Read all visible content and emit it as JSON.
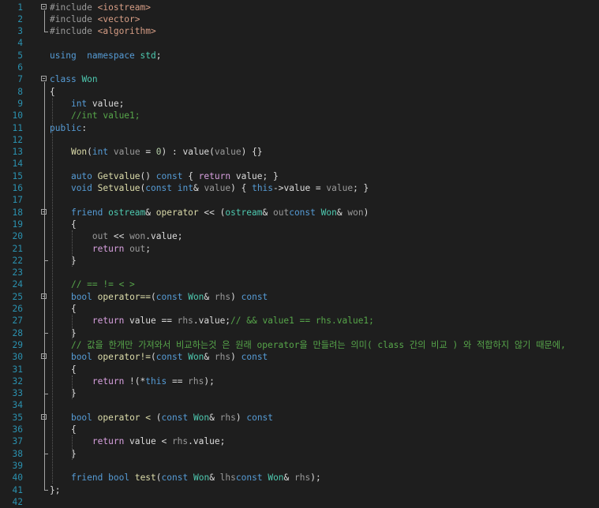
{
  "lines": [
    {
      "n": "1",
      "fold": true,
      "t": [
        [
          "pp",
          "#include "
        ],
        [
          "str",
          "<iostream>"
        ]
      ]
    },
    {
      "n": "2",
      "t": [
        [
          "pp",
          "#include "
        ],
        [
          "str",
          "<vector>"
        ]
      ]
    },
    {
      "n": "3",
      "t": [
        [
          "pp",
          "#include "
        ],
        [
          "str",
          "<algorithm>"
        ]
      ]
    },
    {
      "n": "4",
      "t": []
    },
    {
      "n": "5",
      "t": [
        [
          "kw",
          "using"
        ],
        [
          "",
          "  "
        ],
        [
          "kw",
          "namespace"
        ],
        [
          "",
          " "
        ],
        [
          "ty",
          "std"
        ],
        [
          "",
          ";"
        ]
      ]
    },
    {
      "n": "6",
      "t": []
    },
    {
      "n": "7",
      "fold": true,
      "t": [
        [
          "kw",
          "class"
        ],
        [
          "",
          " "
        ],
        [
          "ty",
          "Won"
        ]
      ]
    },
    {
      "n": "8",
      "t": [
        [
          "",
          "{"
        ]
      ]
    },
    {
      "n": "9",
      "t": [
        [
          "",
          "    "
        ],
        [
          "kw",
          "int"
        ],
        [
          "",
          " value;"
        ]
      ]
    },
    {
      "n": "10",
      "t": [
        [
          "",
          "    "
        ],
        [
          "cm",
          "//int value1;"
        ]
      ]
    },
    {
      "n": "11",
      "t": [
        [
          "kw",
          "public"
        ],
        [
          "",
          ":"
        ]
      ]
    },
    {
      "n": "12",
      "t": []
    },
    {
      "n": "13",
      "t": [
        [
          "",
          "    "
        ],
        [
          "fn",
          "Won"
        ],
        [
          "",
          "("
        ],
        [
          "kw",
          "int"
        ],
        [
          "",
          " "
        ],
        [
          "pm",
          "value"
        ],
        [
          "",
          " = "
        ],
        [
          "nm",
          "0"
        ],
        [
          "",
          ") : value("
        ],
        [
          "pm",
          "value"
        ],
        [
          "",
          ") {}"
        ]
      ]
    },
    {
      "n": "14",
      "t": []
    },
    {
      "n": "15",
      "t": [
        [
          "",
          "    "
        ],
        [
          "kw",
          "auto"
        ],
        [
          "",
          " "
        ],
        [
          "fn",
          "Getvalue"
        ],
        [
          "",
          "() "
        ],
        [
          "kw",
          "const"
        ],
        [
          "",
          " { "
        ],
        [
          "ctl",
          "return"
        ],
        [
          "",
          " value; }"
        ]
      ]
    },
    {
      "n": "16",
      "t": [
        [
          "",
          "    "
        ],
        [
          "kw",
          "void"
        ],
        [
          "",
          " "
        ],
        [
          "fn",
          "Setvalue"
        ],
        [
          "",
          "("
        ],
        [
          "kw",
          "const"
        ],
        [
          "",
          " "
        ],
        [
          "kw",
          "int"
        ],
        [
          "",
          "& "
        ],
        [
          "pm",
          "value"
        ],
        [
          "",
          ") { "
        ],
        [
          "kw",
          "this"
        ],
        [
          "",
          "->value = "
        ],
        [
          "pm",
          "value"
        ],
        [
          "",
          "; }"
        ]
      ]
    },
    {
      "n": "17",
      "t": []
    },
    {
      "n": "18",
      "fold": true,
      "t": [
        [
          "",
          "    "
        ],
        [
          "kw",
          "friend"
        ],
        [
          "",
          " "
        ],
        [
          "ty",
          "ostream"
        ],
        [
          "",
          "& "
        ],
        [
          "fn",
          "operator"
        ],
        [
          "",
          " << ("
        ],
        [
          "ty",
          "ostream"
        ],
        [
          "",
          "& "
        ],
        [
          "pm",
          "out"
        ],
        [
          ", "
        ],
        [
          "kw",
          "const"
        ],
        [
          "",
          " "
        ],
        [
          "ty",
          "Won"
        ],
        [
          "",
          "& "
        ],
        [
          "pm",
          "won"
        ],
        [
          "",
          ")"
        ]
      ]
    },
    {
      "n": "19",
      "t": [
        [
          "",
          "    {"
        ]
      ]
    },
    {
      "n": "20",
      "t": [
        [
          "",
          "        "
        ],
        [
          "pm",
          "out"
        ],
        [
          "",
          " << "
        ],
        [
          "pm",
          "won"
        ],
        [
          "",
          ".value;"
        ]
      ]
    },
    {
      "n": "21",
      "t": [
        [
          "",
          "        "
        ],
        [
          "ctl",
          "return"
        ],
        [
          "",
          " "
        ],
        [
          "pm",
          "out"
        ],
        [
          "",
          ";"
        ]
      ]
    },
    {
      "n": "22",
      "t": [
        [
          "",
          "    }"
        ]
      ]
    },
    {
      "n": "23",
      "t": []
    },
    {
      "n": "24",
      "t": [
        [
          "",
          "    "
        ],
        [
          "cm",
          "// == != < >"
        ]
      ]
    },
    {
      "n": "25",
      "fold": true,
      "t": [
        [
          "",
          "    "
        ],
        [
          "kw",
          "bool"
        ],
        [
          "",
          " "
        ],
        [
          "fn",
          "operator=="
        ],
        [
          "",
          "("
        ],
        [
          "kw",
          "const"
        ],
        [
          "",
          " "
        ],
        [
          "ty",
          "Won"
        ],
        [
          "",
          "& "
        ],
        [
          "pm",
          "rhs"
        ],
        [
          "",
          ") "
        ],
        [
          "kw",
          "const"
        ]
      ]
    },
    {
      "n": "26",
      "t": [
        [
          "",
          "    {"
        ]
      ]
    },
    {
      "n": "27",
      "t": [
        [
          "",
          "        "
        ],
        [
          "ctl",
          "return"
        ],
        [
          "",
          " value == "
        ],
        [
          "pm",
          "rhs"
        ],
        [
          "",
          ".value;"
        ],
        [
          "cm",
          "// && value1 == rhs.value1;"
        ]
      ]
    },
    {
      "n": "28",
      "t": [
        [
          "",
          "    }"
        ]
      ]
    },
    {
      "n": "29",
      "t": [
        [
          "",
          "    "
        ],
        [
          "cm",
          "// 값을 한개만 가져와서 비교하는것 은 원래 operator을 만들려는 의미( class 간의 비교 ) 와 적합하지 않기 때문에,"
        ]
      ]
    },
    {
      "n": "30",
      "fold": true,
      "t": [
        [
          "",
          "    "
        ],
        [
          "kw",
          "bool"
        ],
        [
          "",
          " "
        ],
        [
          "fn",
          "operator!="
        ],
        [
          "",
          "("
        ],
        [
          "kw",
          "const"
        ],
        [
          "",
          " "
        ],
        [
          "ty",
          "Won"
        ],
        [
          "",
          "& "
        ],
        [
          "pm",
          "rhs"
        ],
        [
          "",
          ") "
        ],
        [
          "kw",
          "const"
        ]
      ]
    },
    {
      "n": "31",
      "t": [
        [
          "",
          "    {"
        ]
      ]
    },
    {
      "n": "32",
      "t": [
        [
          "",
          "        "
        ],
        [
          "ctl",
          "return"
        ],
        [
          "",
          " !(*"
        ],
        [
          "kw",
          "this"
        ],
        [
          "",
          " == "
        ],
        [
          "pm",
          "rhs"
        ],
        [
          "",
          ");"
        ]
      ]
    },
    {
      "n": "33",
      "t": [
        [
          "",
          "    }"
        ]
      ]
    },
    {
      "n": "34",
      "t": []
    },
    {
      "n": "35",
      "fold": true,
      "t": [
        [
          "",
          "    "
        ],
        [
          "kw",
          "bool"
        ],
        [
          "",
          " "
        ],
        [
          "fn",
          "operator <"
        ],
        [
          "",
          " ("
        ],
        [
          "kw",
          "const"
        ],
        [
          "",
          " "
        ],
        [
          "ty",
          "Won"
        ],
        [
          "",
          "& "
        ],
        [
          "pm",
          "rhs"
        ],
        [
          "",
          ") "
        ],
        [
          "kw",
          "const"
        ]
      ]
    },
    {
      "n": "36",
      "t": [
        [
          "",
          "    {"
        ]
      ]
    },
    {
      "n": "37",
      "t": [
        [
          "",
          "        "
        ],
        [
          "ctl",
          "return"
        ],
        [
          "",
          " value < "
        ],
        [
          "pm",
          "rhs"
        ],
        [
          "",
          ".value;"
        ]
      ]
    },
    {
      "n": "38",
      "t": [
        [
          "",
          "    }"
        ]
      ]
    },
    {
      "n": "39",
      "t": []
    },
    {
      "n": "40",
      "t": [
        [
          "",
          "    "
        ],
        [
          "kw",
          "friend"
        ],
        [
          "",
          " "
        ],
        [
          "kw",
          "bool"
        ],
        [
          "",
          " "
        ],
        [
          "fn",
          "test"
        ],
        [
          "",
          "("
        ],
        [
          "kw",
          "const"
        ],
        [
          "",
          " "
        ],
        [
          "ty",
          "Won"
        ],
        [
          "",
          "& "
        ],
        [
          "pm",
          "lhs"
        ],
        [
          ", "
        ],
        [
          "kw",
          "const"
        ],
        [
          "",
          " "
        ],
        [
          "ty",
          "Won"
        ],
        [
          "",
          "& "
        ],
        [
          "pm",
          "rhs"
        ],
        [
          "",
          ");"
        ]
      ]
    },
    {
      "n": "41",
      "t": [
        [
          "",
          "};"
        ]
      ]
    },
    {
      "n": "42",
      "t": []
    }
  ],
  "colors": {
    "background": "#1e1e1e",
    "line_number": "#2b91af",
    "keyword": "#569cd6",
    "type": "#4ec9b0",
    "function": "#dcdcaa",
    "string": "#d69d85",
    "comment": "#57a64a",
    "number": "#b5cea8",
    "control": "#d8a0df"
  },
  "icons": {
    "fold": "collapse-minus-icon"
  }
}
